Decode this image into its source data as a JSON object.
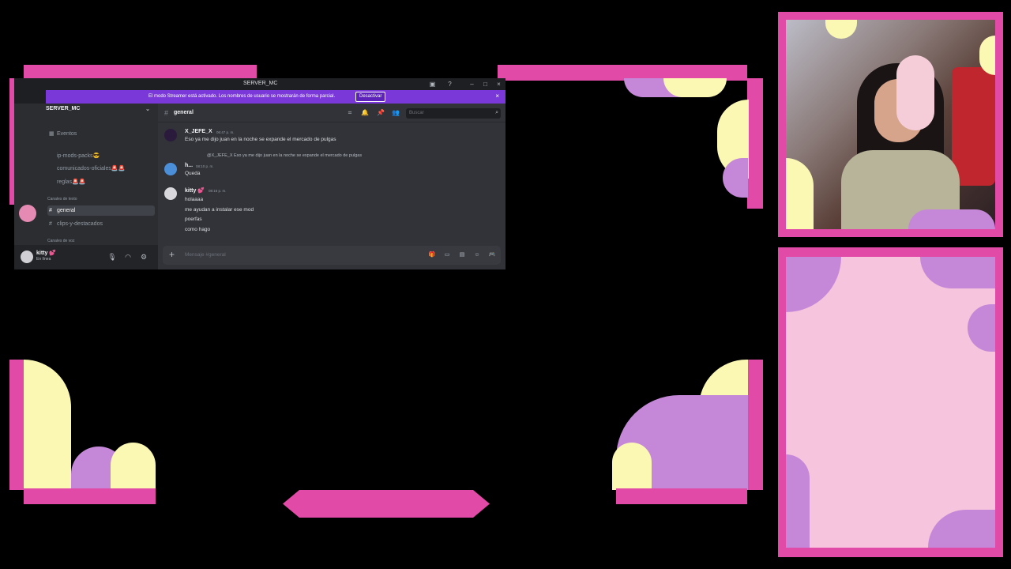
{
  "window": {
    "title": "SERVER_MC",
    "server_badge": "8"
  },
  "banner": {
    "message": "El modo Streamer está activado. Los nombres de usuario se mostrarán de forma parcial.",
    "button": "Desactivar"
  },
  "sidebar": {
    "server_name": "SERVER_MC",
    "events": "Eventos",
    "channels_top": [
      {
        "label": "ip-mods-packs😎"
      },
      {
        "label": "comunicados-oficiales🚨🚨"
      },
      {
        "label": "reglas🚨🚨"
      }
    ],
    "category_text": "Canales de texto",
    "channels_text": [
      {
        "label": "general"
      },
      {
        "label": "clips-y-destacados"
      }
    ],
    "category_voice": "Canales de voz",
    "nuevo_badge": "NUEVO",
    "guild_badge": "16"
  },
  "user": {
    "name": "kitty 💕",
    "status": "En línea"
  },
  "channel": {
    "name": "general",
    "search_placeholder": "Buscar"
  },
  "messages": [
    {
      "author": "X_JEFE_X",
      "time": "06:47 p. m.",
      "lines": [
        "Eso ya me dijo juan en la noche se expande el mercado de pulgas"
      ]
    },
    {
      "author": "h...",
      "time": "08:10 p. m.",
      "reply": "@X_JEFE_X Eso ya me dijo juan en la noche se expande el mercado de pulgas",
      "lines": [
        "Queda"
      ]
    },
    {
      "author": "kitty 💕",
      "time": "08:16 p. m.",
      "lines": [
        "holaaaa",
        "me ayudan a instalar ese mod",
        "poerfas",
        "como hago"
      ]
    }
  ],
  "composer": {
    "placeholder": "Mensaje #general"
  }
}
